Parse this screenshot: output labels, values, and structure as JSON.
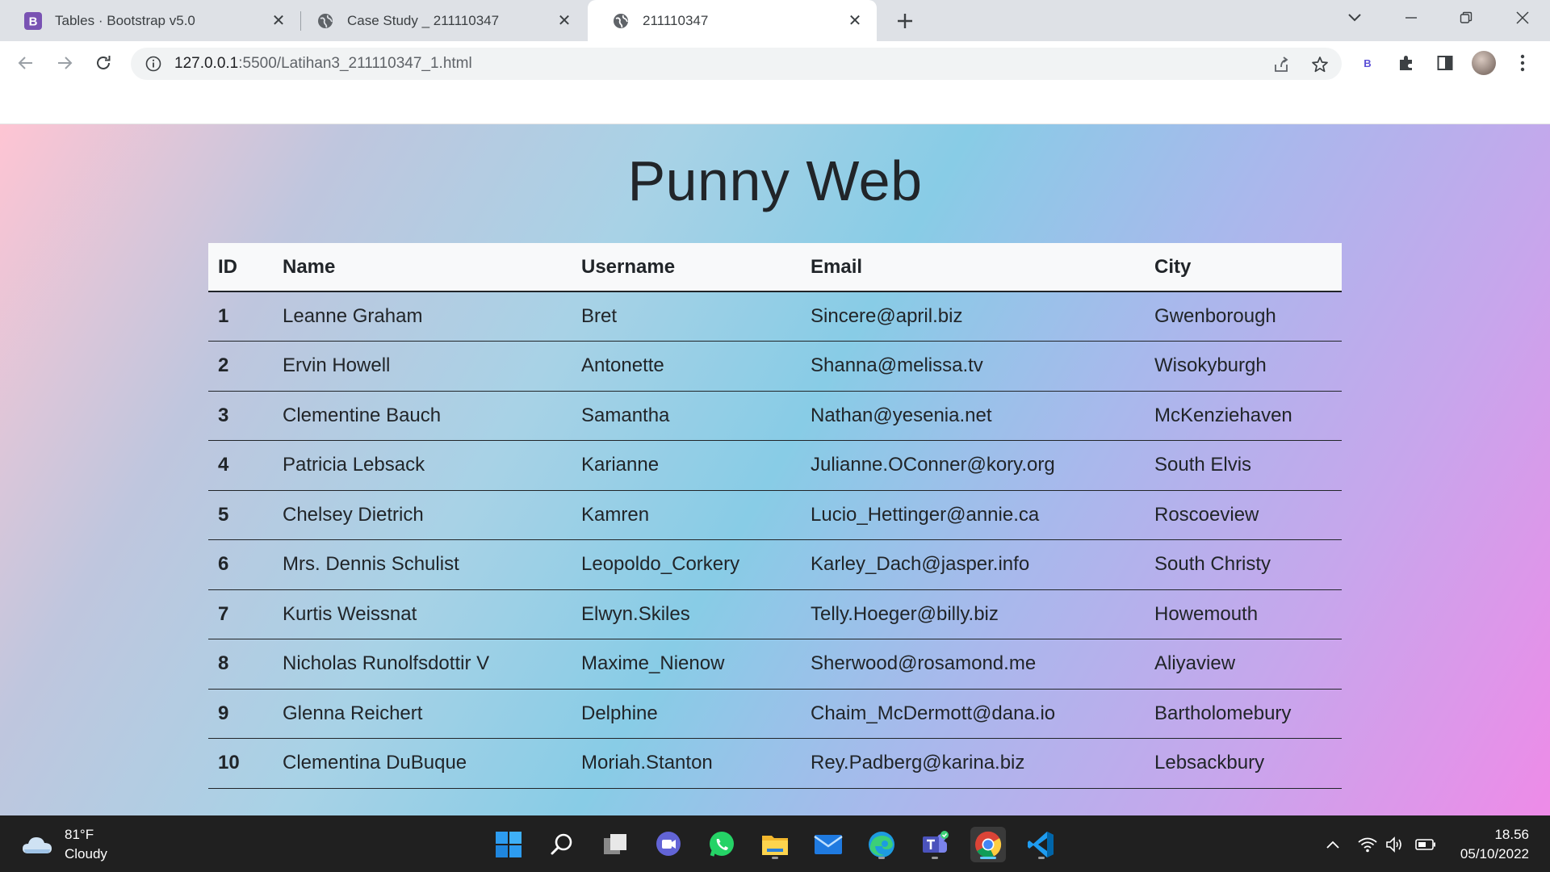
{
  "browser": {
    "tabs": [
      {
        "title": "Tables · Bootstrap v5.0",
        "favicon": "bootstrap-icon",
        "active": false
      },
      {
        "title": "Case Study _ 211110347",
        "favicon": "globe-icon",
        "active": false
      },
      {
        "title": "211110347",
        "favicon": "globe-icon",
        "active": true
      }
    ],
    "url_host": "127.0.0.1",
    "url_rest": ":5500/Latihan3_211110347_1.html",
    "extension_label": "B"
  },
  "page": {
    "title": "Punny Web",
    "table": {
      "headers": [
        "ID",
        "Name",
        "Username",
        "Email",
        "City"
      ],
      "rows": [
        [
          "1",
          "Leanne Graham",
          "Bret",
          "Sincere@april.biz",
          "Gwenborough"
        ],
        [
          "2",
          "Ervin Howell",
          "Antonette",
          "Shanna@melissa.tv",
          "Wisokyburgh"
        ],
        [
          "3",
          "Clementine Bauch",
          "Samantha",
          "Nathan@yesenia.net",
          "McKenziehaven"
        ],
        [
          "4",
          "Patricia Lebsack",
          "Karianne",
          "Julianne.OConner@kory.org",
          "South Elvis"
        ],
        [
          "5",
          "Chelsey Dietrich",
          "Kamren",
          "Lucio_Hettinger@annie.ca",
          "Roscoeview"
        ],
        [
          "6",
          "Mrs. Dennis Schulist",
          "Leopoldo_Corkery",
          "Karley_Dach@jasper.info",
          "South Christy"
        ],
        [
          "7",
          "Kurtis Weissnat",
          "Elwyn.Skiles",
          "Telly.Hoeger@billy.biz",
          "Howemouth"
        ],
        [
          "8",
          "Nicholas Runolfsdottir V",
          "Maxime_Nienow",
          "Sherwood@rosamond.me",
          "Aliyaview"
        ],
        [
          "9",
          "Glenna Reichert",
          "Delphine",
          "Chaim_McDermott@dana.io",
          "Bartholomebury"
        ],
        [
          "10",
          "Clementina DuBuque",
          "Moriah.Stanton",
          "Rey.Padberg@karina.biz",
          "Lebsackbury"
        ]
      ]
    }
  },
  "taskbar": {
    "weather_temp": "81°F",
    "weather_desc": "Cloudy",
    "time": "18.56",
    "date": "05/10/2022"
  },
  "colors": {
    "gradient_start": "#fec5d3",
    "gradient_mid": "#88cce6",
    "gradient_end": "#ee8be8",
    "text": "#212529",
    "bootstrap_purple": "#7952b3"
  }
}
